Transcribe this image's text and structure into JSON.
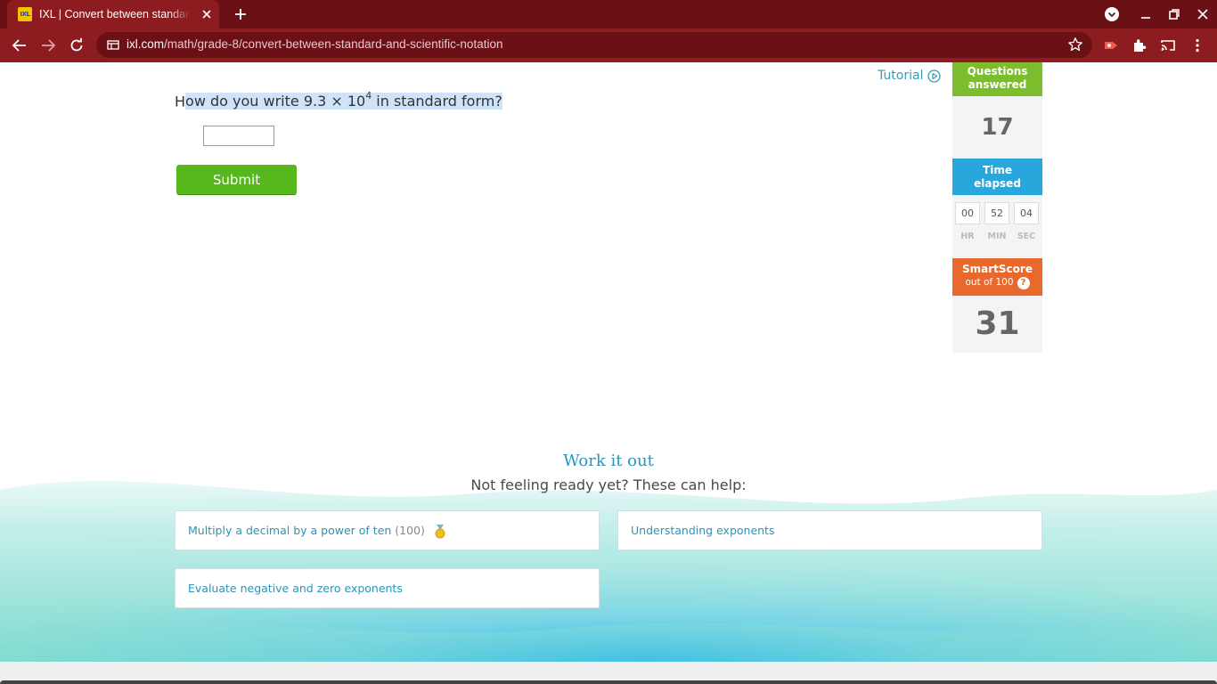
{
  "browser": {
    "tab_title": "IXL | Convert between standard and scientific notation",
    "favicon_text": "IXL",
    "url_domain": "ixl.com",
    "url_path": "/math/grade-8/convert-between-standard-and-scientific-notation",
    "theme_color": "#8c1c20"
  },
  "question": {
    "prefix": "H",
    "text_before_exp": "ow do you write 9.3 × 10",
    "exponent": "4",
    "text_after_exp": " in standard form?",
    "answer_value": "",
    "submit_label": "Submit",
    "submit_color": "#56b81c"
  },
  "tutorial": {
    "label": "Tutorial"
  },
  "stats": {
    "questions_answered_label_line1": "Questions",
    "questions_answered_label_line2": "answered",
    "questions_answered_value": "17",
    "time_label_line1": "Time",
    "time_label_line2": "elapsed",
    "hours": "00",
    "minutes": "52",
    "seconds": "04",
    "hours_label": "HR",
    "minutes_label": "MIN",
    "seconds_label": "SEC",
    "smartscore_label": "SmartScore",
    "smartscore_sub": "out of 100",
    "smartscore_help": "?",
    "smartscore_value": "31",
    "colors": {
      "questions": "#7cbd2e",
      "time": "#28a7dc",
      "smartscore": "#e9692c"
    }
  },
  "work_it_out": {
    "title": "Work it out",
    "subtitle": "Not feeling ready yet? These can help:",
    "skills": [
      {
        "label": "Multiply a decimal by a power of ten",
        "score": "(100)",
        "icon": "medal-icon"
      },
      {
        "label": "Understanding exponents"
      },
      {
        "label": "Evaluate negative and zero exponents"
      }
    ]
  }
}
